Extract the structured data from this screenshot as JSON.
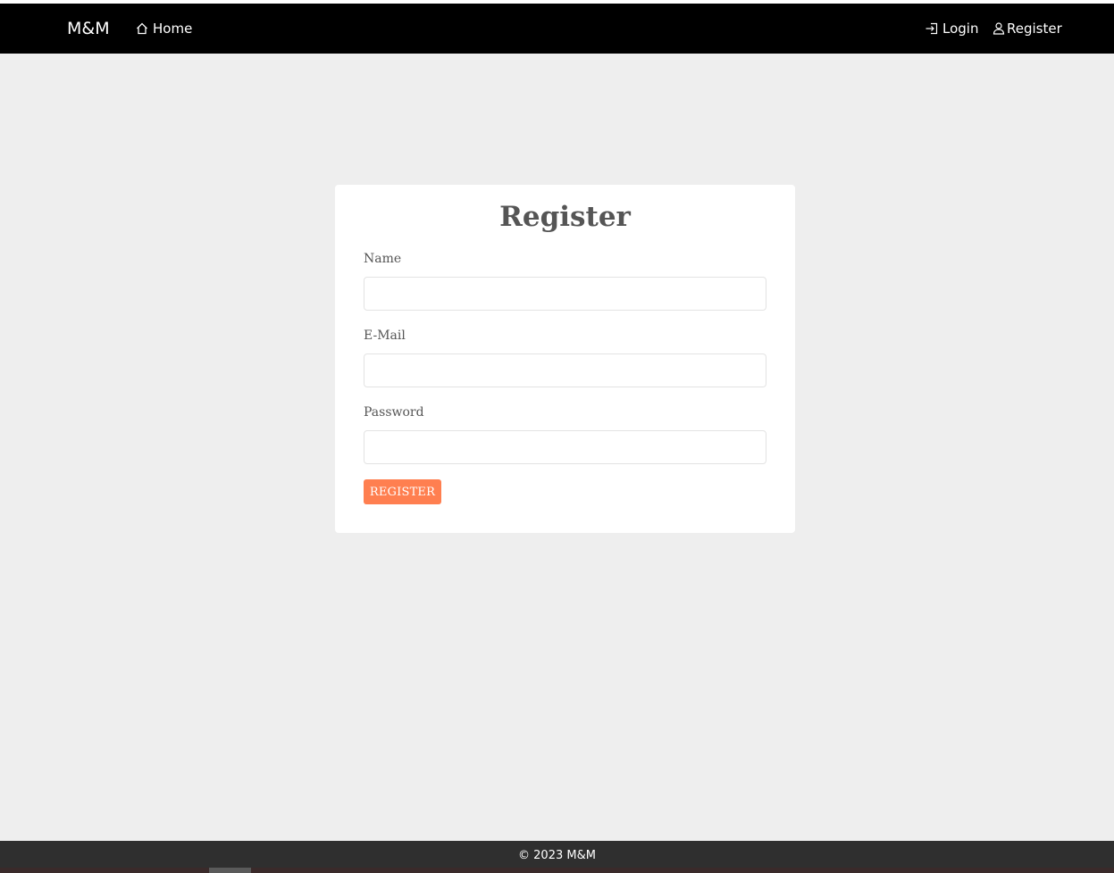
{
  "navbar": {
    "brand": "M&M",
    "home_label": "Home",
    "login_label": "Login",
    "register_label": "Register",
    "home_icon": "home-icon",
    "login_icon": "login-icon",
    "register_icon": "user-icon"
  },
  "form": {
    "title": "Register",
    "name_label": "Name",
    "name_value": "",
    "email_label": "E-Mail",
    "email_value": "",
    "password_label": "Password",
    "password_value": "",
    "submit_label": "REGISTER"
  },
  "footer": {
    "text": "© 2023 M&M"
  },
  "colors": {
    "navbar_bg": "#000000",
    "page_bg": "#eeeeee",
    "accent": "#ff7f50",
    "footer_bg": "#2f2f2f"
  }
}
